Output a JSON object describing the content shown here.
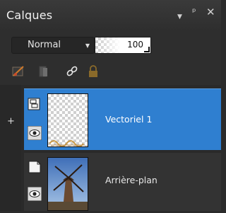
{
  "panel": {
    "title": "Calques",
    "icons": [
      "menu-down-icon",
      "pin-icon",
      "close-icon"
    ]
  },
  "blend": {
    "mode": "Normal"
  },
  "opacity": {
    "value": "100"
  },
  "tools": [
    "brush-edit-icon",
    "mask-icon",
    "link-icon",
    "lock-icon"
  ],
  "layers": [
    {
      "name": "Vectoriel 1",
      "selected": true,
      "type_icon": "vector-layer-icon",
      "visible_icon": "eye-icon"
    },
    {
      "name": "Arrière-plan",
      "selected": false,
      "type_icon": "raster-layer-icon",
      "visible_icon": "eye-icon"
    }
  ],
  "colors": {
    "selection": "#2f7fd0",
    "panel_bg": "#2f2f2f"
  }
}
